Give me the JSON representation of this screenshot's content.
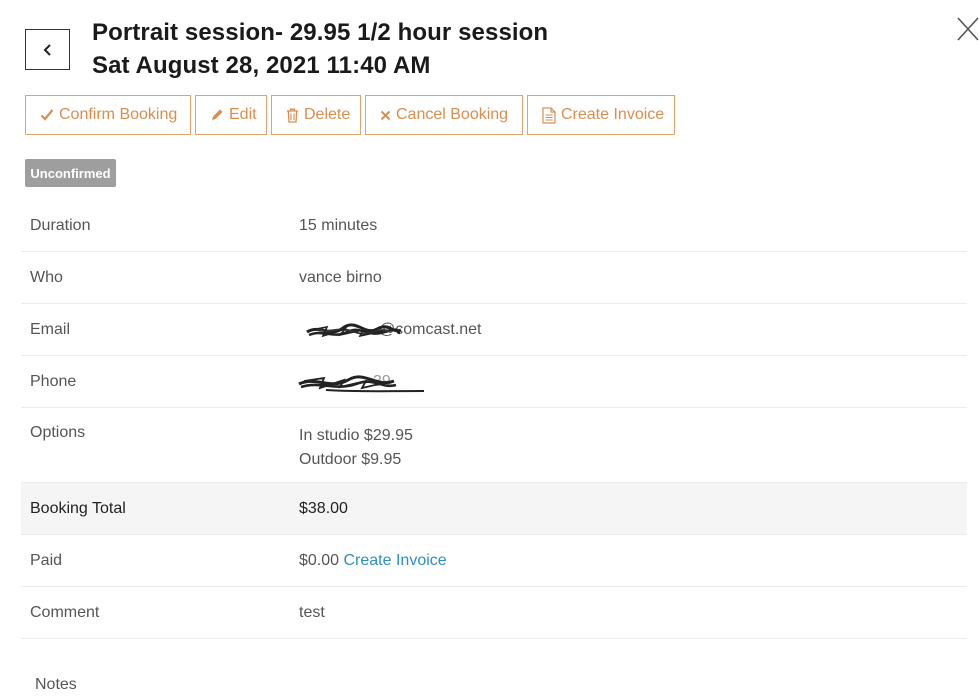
{
  "header": {
    "title_line1": "Portrait session- 29.95 1/2 hour session",
    "title_line2": "Sat August 28, 2021 11:40 AM"
  },
  "toolbar": {
    "confirm_label": "Confirm Booking",
    "edit_label": "Edit",
    "delete_label": "Delete",
    "cancel_label": "Cancel Booking",
    "invoice_label": "Create Invoice"
  },
  "status": {
    "badge": "Unconfirmed"
  },
  "details": {
    "duration": {
      "label": "Duration",
      "value": "15 minutes"
    },
    "who": {
      "label": "Who",
      "value": "vance birno"
    },
    "email": {
      "label": "Email",
      "value": "@comcast.net"
    },
    "phone": {
      "label": "Phone",
      "value": "39"
    },
    "options": {
      "label": "Options",
      "values": [
        "In studio $29.95",
        "Outdoor $9.95"
      ]
    },
    "total": {
      "label": "Booking Total",
      "value": "$38.00"
    },
    "paid": {
      "label": "Paid",
      "value": "$0.00",
      "link": "Create Invoice"
    },
    "comment": {
      "label": "Comment",
      "value": "test"
    }
  },
  "notes": {
    "label": "Notes"
  },
  "colors": {
    "accent": "#d98e4e",
    "accent_border": "#e0a36a",
    "badge": "#9e9e9e",
    "link": "#2f8fc0",
    "highlight_row": "#f5f5f5"
  },
  "icons": {
    "back": "chevron-left-icon",
    "close": "close-icon",
    "confirm": "check-icon",
    "edit": "pencil-icon",
    "delete": "trash-icon",
    "cancel": "x-icon",
    "invoice": "document-icon"
  }
}
